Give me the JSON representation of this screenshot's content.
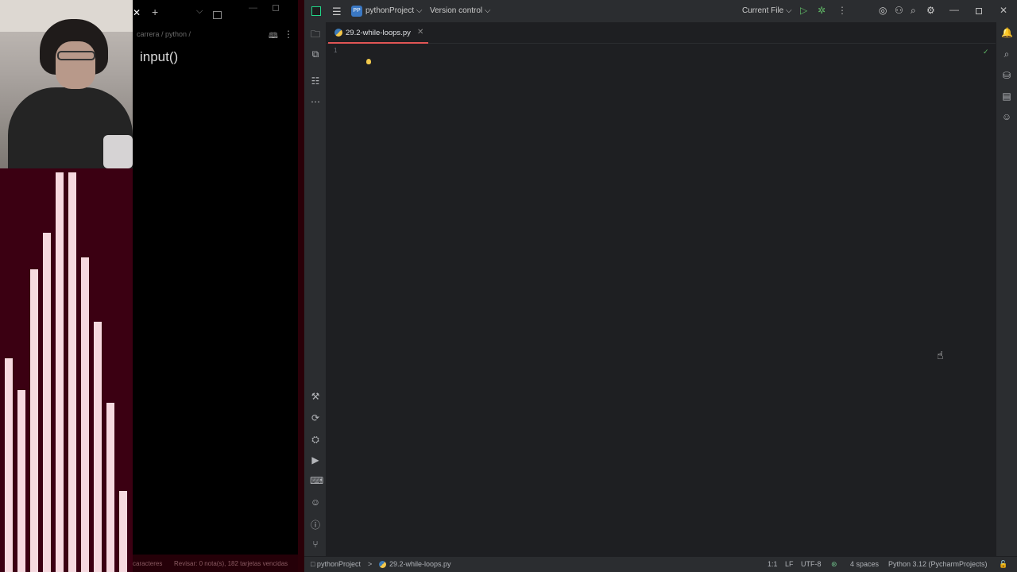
{
  "notes": {
    "breadcrumb": "carrera / python /",
    "title": "input()",
    "status_left": "caracteres",
    "status_right": "Revisar: 0 nota(s), 182 tarjetas vencidas",
    "close_glyph": "✕",
    "plus_glyph": "+",
    "chevron_glyph": "⌵",
    "book_glyph": "🕮",
    "more_glyph": "⋮",
    "min_glyph": "—"
  },
  "audio_bars": [
    0.53,
    0.45,
    0.75,
    0.84,
    0.99,
    0.99,
    0.78,
    0.62,
    0.42,
    0.2
  ],
  "ide": {
    "logo_icon": "pycharm-logo-icon",
    "hamburger_glyph": "☰",
    "project_badge": "PP",
    "project_name": "pythonProject ⌵",
    "vcs": "Version control ⌵",
    "run_config": "Current File ⌵",
    "run_glyph": "▷",
    "debug_glyph": "✲",
    "kebab_glyph": "⋮",
    "ai_glyph": "◎",
    "user_glyph": "⚇",
    "search_glyph": "⌕",
    "gear_glyph": "⚙",
    "min_glyph": "—",
    "close_glyph": "✕",
    "tab": {
      "file": "29.2-while-loops.py",
      "close": "✕"
    },
    "editor": {
      "line_number": "1",
      "check": "✓",
      "hand": "☝"
    },
    "left_tools_top": [
      "🗀",
      "⧉",
      "☷",
      "⋯"
    ],
    "left_tools_bottom": [
      "⚒",
      "⟳",
      "⛭",
      "▶",
      "⌨",
      "☺",
      "ⓘ",
      "⑂"
    ],
    "right_tools": [
      "🔔",
      "⌕",
      "⛁",
      "▤",
      "☺"
    ],
    "status": {
      "project": "□ pythonProject",
      "sep": ">",
      "file": "29.2-while-loops.py",
      "position": "1:1",
      "line_sep": "LF",
      "encoding": "UTF-8",
      "indent": "4 spaces",
      "interpreter": "Python 3.12 (PycharmProjects)",
      "lock_glyph": "🔓"
    },
    "colors": {
      "accent_tab": "#e05555",
      "run": "#5fb865",
      "bg": "#1e1f22",
      "panel": "#2b2d30"
    }
  }
}
